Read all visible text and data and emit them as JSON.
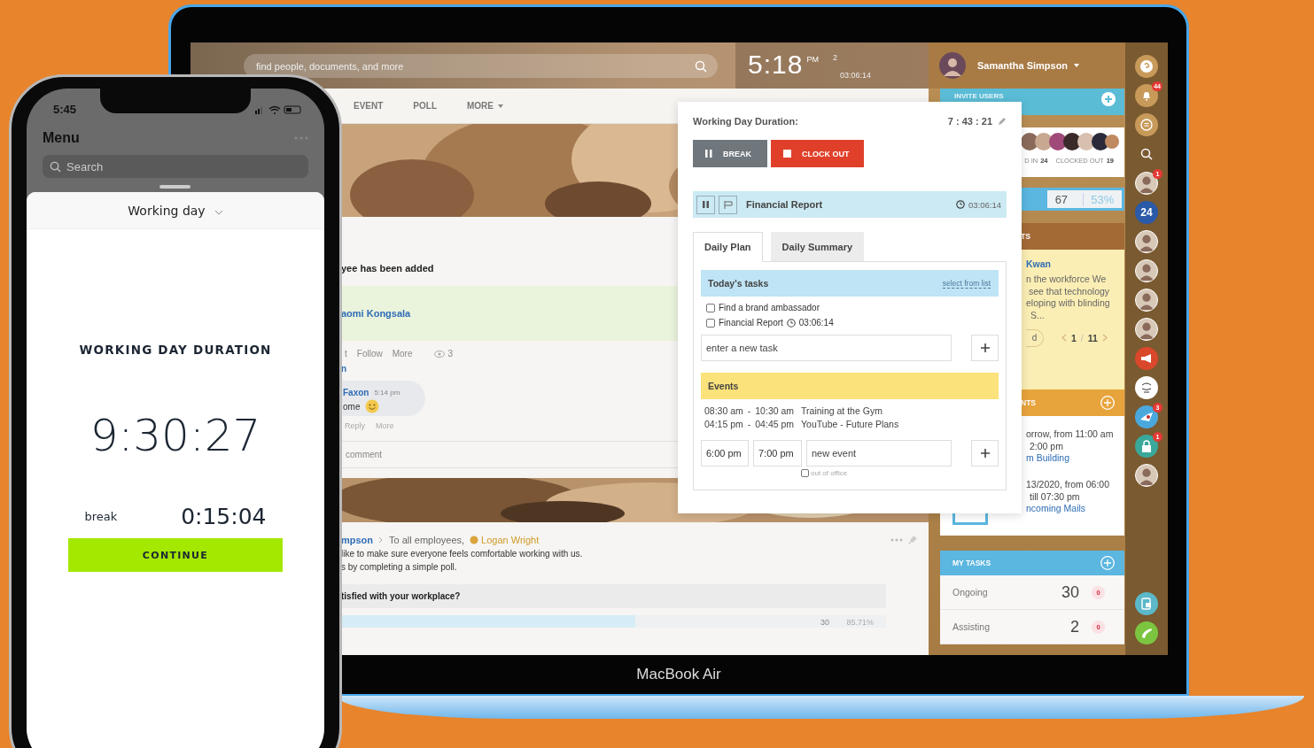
{
  "laptop": {
    "label": "MacBook Air",
    "search": {
      "placeholder": "find people, documents, and more"
    },
    "clock": {
      "time": "5:18",
      "ampm": "PM",
      "flag_count": "2",
      "timer": "03:06:14"
    },
    "user": {
      "name": "Samantha Simpson"
    },
    "feed_tabs": [
      {
        "label": "EVENT",
        "dropdown": false
      },
      {
        "label": "POLL",
        "dropdown": false
      },
      {
        "label": "MORE",
        "dropdown": true
      }
    ],
    "post": {
      "title": "yee has been added",
      "person": "aomi Kongsala",
      "actions": [
        "t",
        "Follow",
        "More"
      ],
      "views": "3",
      "fragment": "n",
      "comment_author": "Faxon",
      "comment_time": "5:14 pm",
      "comment_text": "ome",
      "comment_actions": [
        "Reply",
        "More"
      ],
      "comment_placeholder": "comment"
    },
    "poll_post": {
      "author": "mpson",
      "audience": "To all employees,",
      "mention": "Logan Wright",
      "lines": [
        "like to make sure everyone feels comfortable working with us.",
        "s by completing a simple poll."
      ],
      "question": "tisfied with your workplace?",
      "option": {
        "count": "30",
        "percent": "85.71%",
        "level": 0.64
      }
    },
    "popup": {
      "title": "Working Day Duration:",
      "duration": "7 : 43 : 21",
      "buttons": [
        {
          "kind": "break",
          "label": "BREAK"
        },
        {
          "kind": "clock_out",
          "label": "CLOCK OUT"
        }
      ],
      "current_task": {
        "name": "Financial Report",
        "timer": "03:06:14"
      },
      "tabs": [
        {
          "label": "Daily Plan",
          "selected": true
        },
        {
          "label": "Daily Summary",
          "selected": false
        }
      ],
      "tasks_title": "Today's tasks",
      "select_link": "select from list",
      "tasks": [
        {
          "label": "Find a brand ambassador",
          "checked": false
        },
        {
          "label": "Financial Report",
          "timer": "03:06:14",
          "checked": false
        }
      ],
      "new_task": {
        "placeholder": "enter a new task"
      },
      "events_title": "Events",
      "events": [
        {
          "start": "08:30 am",
          "sep": "-",
          "end": "10:30 am",
          "title": "Training at the Gym"
        },
        {
          "start": "04:15 pm",
          "sep": "-",
          "end": "04:45 pm",
          "title": "YouTube - Future Plans"
        }
      ],
      "new_event": {
        "start": "6:00 pm",
        "end": "7:00 pm",
        "placeholder": "new event",
        "out_of_office_label": "out of office",
        "out_of_office": false
      }
    },
    "panel": {
      "invite_title": "INVITE USERS",
      "clocked_in_label": "D IN",
      "clocked_in_count": "24",
      "clocked_out_label": "CLOCKED OUT",
      "clocked_out_count": "19",
      "stat_value": "67",
      "stat_percent": "53%",
      "news_header": "TS",
      "news_author": "Kwan",
      "news_lines": [
        "n the workforce We",
        "see that technology",
        "eloping with blinding",
        "S..."
      ],
      "news_button": "d",
      "pager": {
        "current": "1",
        "sep": "/",
        "total": "11"
      },
      "events_header": "NTS",
      "events": [
        {
          "lines": [
            "orrow, from 11:00 am",
            "2:00 pm"
          ],
          "link": "m Building"
        },
        {
          "lines": [
            "13/2020, from 06:00",
            "till 07:30 pm"
          ],
          "link": "ncoming Mails"
        }
      ],
      "tasks_header": "MY TASKS",
      "tasks": [
        {
          "label": "Ongoing",
          "count": "30",
          "badge": "0"
        },
        {
          "label": "Assisting",
          "count": "2",
          "badge": "0"
        }
      ]
    },
    "rail": [
      {
        "kind": "help"
      },
      {
        "kind": "bell",
        "badge": "44"
      },
      {
        "kind": "chat"
      },
      {
        "kind": "search"
      },
      {
        "kind": "avatar",
        "badge": "1"
      },
      {
        "kind": "count",
        "label": "24"
      },
      {
        "kind": "avatar"
      },
      {
        "kind": "avatar"
      },
      {
        "kind": "avatar"
      },
      {
        "kind": "avatar"
      },
      {
        "kind": "megaphone"
      },
      {
        "kind": "sticker"
      },
      {
        "kind": "globe",
        "badge": "3"
      },
      {
        "kind": "lock",
        "badge": "1"
      },
      {
        "kind": "avatar"
      },
      {
        "kind": "device"
      },
      {
        "kind": "call"
      }
    ]
  },
  "phone": {
    "status_time": "5:45",
    "title": "Menu",
    "search": {
      "placeholder": "Search"
    },
    "sheet_title": "Working day",
    "duration_label": "WORKING DAY DURATION",
    "duration": "9:30:27",
    "break_label": "break",
    "break_time": "0:15:04",
    "continue_button": "CONTINUE"
  }
}
